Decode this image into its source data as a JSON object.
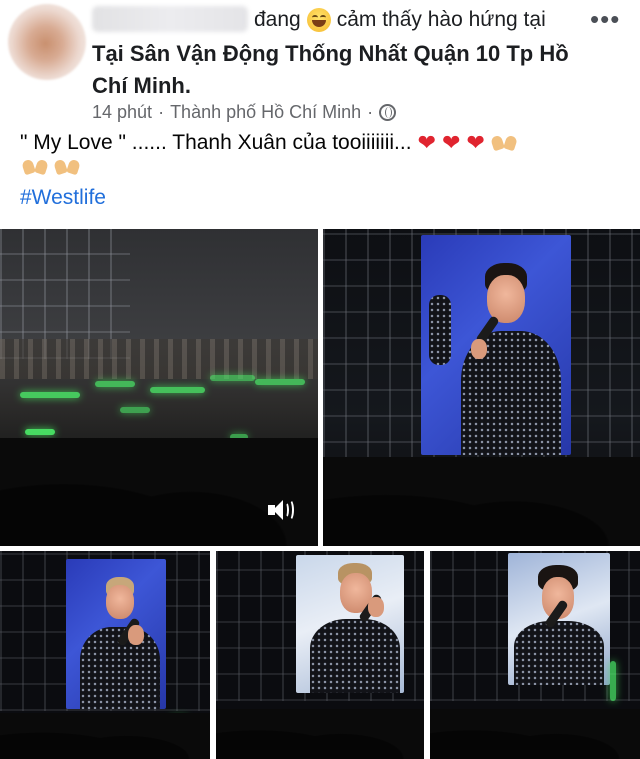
{
  "post": {
    "author_blurred": "",
    "feeling_prefix": "đang",
    "feeling_text": "cảm thấy hào hứng tại",
    "location": "Tại Sân Vận Động Thống Nhất Quận 10 Tp Hồ Chí Minh.",
    "time": "14 phút",
    "separator": "·",
    "city": "Thành phố Hồ Chí Minh",
    "separator2": "·",
    "more_label": "•••",
    "caption": "\" My Love \" ...... Thanh Xuân của tooiiiiiii...",
    "hashtag": "#Westlife",
    "icons": {
      "feeling": "grinning-squint-emoji",
      "heart": "red-heart-emoji",
      "hands": "heart-hands-emoji",
      "privacy": "globe-icon",
      "sound": "volume-icon"
    },
    "colors": {
      "link": "#216fdb",
      "meta": "#65676b",
      "heart": "#e0242f",
      "glowstick": "#4cf06a"
    }
  }
}
